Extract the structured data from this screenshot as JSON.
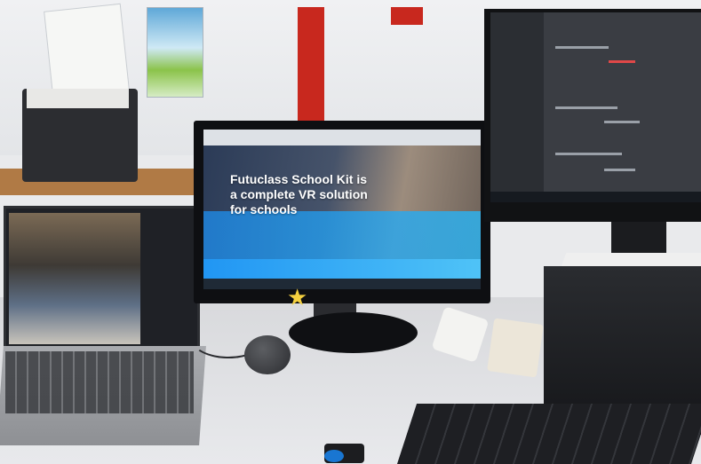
{
  "scene": {
    "description_tags": [
      "desk",
      "laptop",
      "monitor",
      "browser",
      "keyboard",
      "mouse",
      "pc"
    ]
  },
  "center_monitor": {
    "headline": "Futuclass School Kit is\na complete VR solution\nfor schools"
  },
  "colors": {
    "hero_blue": "#2196f3",
    "wall_red": "#c8281e",
    "desk": "#dcdde0"
  }
}
